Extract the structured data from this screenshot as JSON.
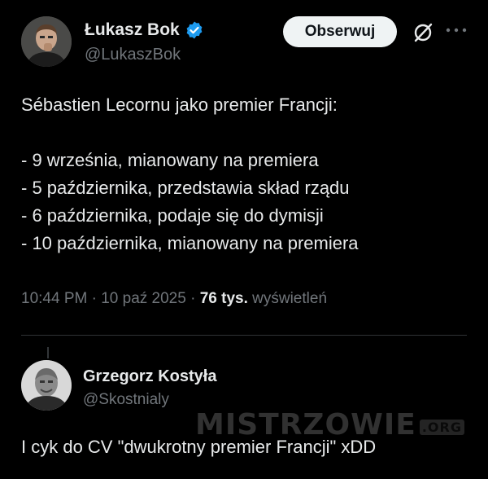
{
  "tweet": {
    "author": {
      "name": "Łukasz Bok",
      "handle": "@LukaszBok",
      "verified": true,
      "avatar_icon": "avatar-photo-man"
    },
    "follow_label": "Obserwuj",
    "text_lines": [
      "Sébastien Lecornu jako premier Francji:",
      "",
      "- 9 września, mianowany na premiera",
      "- 5 października, przedstawia skład rządu",
      "- 6 października, podaje się do dymisji",
      "- 10 października, mianowany na premiera"
    ],
    "time": "10:44 PM",
    "date": "10 paź 2025",
    "separator": "·",
    "views_count": "76 tys.",
    "views_label": "wyświetleń"
  },
  "reply": {
    "author": {
      "name": "Grzegorz Kostyła",
      "handle": "@Skostnialy",
      "avatar_icon": "avatar-photo-bald-man"
    },
    "text": "I cyk do CV \"dwukrotny premier Francji\" xDD"
  },
  "watermark": {
    "main": "MISTRZOWIE",
    "sub": ".ORG"
  },
  "colors": {
    "background": "#000000",
    "text": "#e7e9ea",
    "muted": "#71767b",
    "verified": "#1d9bf0",
    "follow_bg": "#eff3f4"
  }
}
